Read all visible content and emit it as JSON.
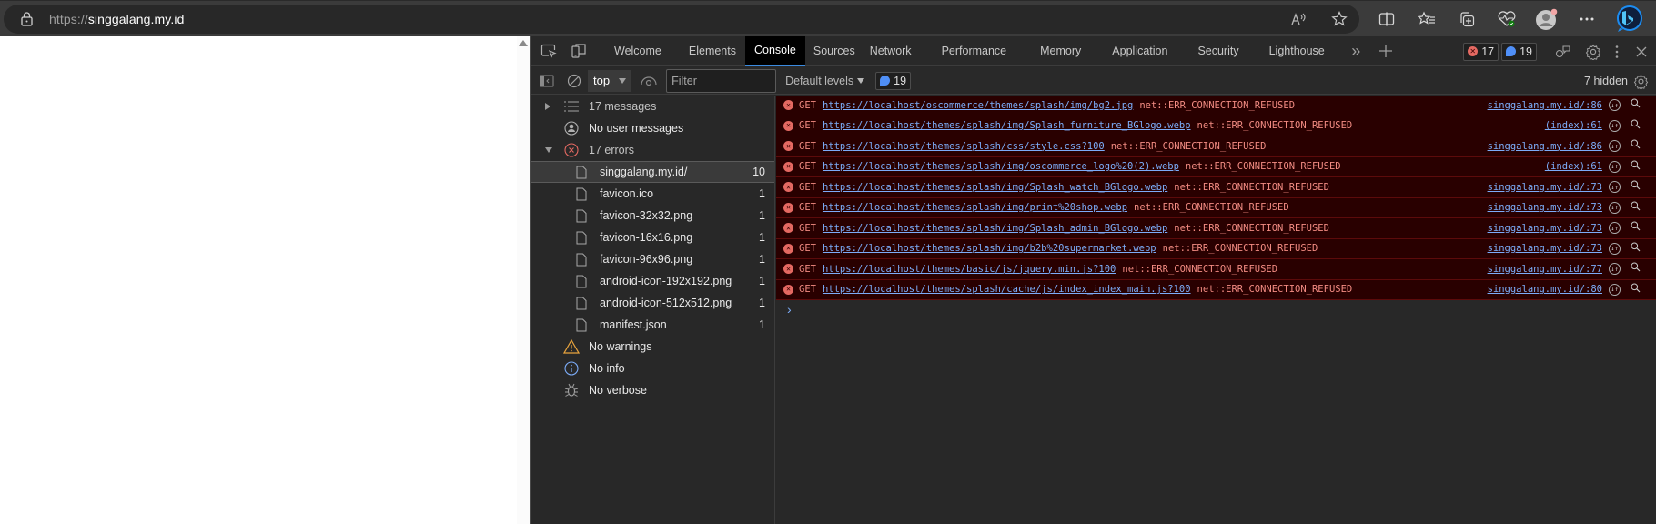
{
  "browser": {
    "url_scheme": "https://",
    "url_host": "singgalang.my.id",
    "address_icons": [
      "read-aloud-icon",
      "favorite-star-icon"
    ],
    "toolbar_icons": [
      "split-screen-icon",
      "favorites-icon",
      "collections-icon",
      "browser-essentials-icon",
      "profile-avatar-icon",
      "more-menu-icon",
      "bing-copilot-icon"
    ]
  },
  "devtools": {
    "tabs": [
      {
        "label": "Welcome",
        "active": false
      },
      {
        "label": "Elements",
        "active": false
      },
      {
        "label": "Console",
        "active": true
      },
      {
        "label": "Sources",
        "active": false
      },
      {
        "label": "Network",
        "active": false
      },
      {
        "label": "Performance",
        "active": false
      },
      {
        "label": "Memory",
        "active": false
      },
      {
        "label": "Application",
        "active": false
      },
      {
        "label": "Security",
        "active": false
      },
      {
        "label": "Lighthouse",
        "active": false
      }
    ],
    "error_count": "17",
    "message_count": "19",
    "toolbar": {
      "context": "top",
      "filter_placeholder": "Filter",
      "levels_label": "Default levels",
      "issues_count": "19",
      "hidden_label": "7 hidden"
    },
    "sidebar": {
      "messages": "17 messages",
      "user_messages": "No user messages",
      "errors": "17 errors",
      "files": [
        {
          "name": "singgalang.my.id/",
          "count": "10"
        },
        {
          "name": "favicon.ico",
          "count": "1"
        },
        {
          "name": "favicon-32x32.png",
          "count": "1"
        },
        {
          "name": "favicon-16x16.png",
          "count": "1"
        },
        {
          "name": "favicon-96x96.png",
          "count": "1"
        },
        {
          "name": "android-icon-192x192.png",
          "count": "1"
        },
        {
          "name": "android-icon-512x512.png",
          "count": "1"
        },
        {
          "name": "manifest.json",
          "count": "1"
        }
      ],
      "warnings": "No warnings",
      "info": "No info",
      "verbose": "No verbose"
    },
    "console": {
      "colors": {
        "error_bg": "#290000",
        "error_text": "#f28b82",
        "link": "#7cacf8"
      },
      "messages": [
        {
          "method": "GET",
          "url": "https://localhost/oscommerce/themes/splash/img/bg2.jpg",
          "error": "net::ERR_CONNECTION_REFUSED",
          "source": "singgalang.my.id/:86"
        },
        {
          "method": "GET",
          "url": "https://localhost/themes/splash/img/Splash_furniture_BGlogo.webp",
          "error": "net::ERR_CONNECTION_REFUSED",
          "source": "(index):61"
        },
        {
          "method": "GET",
          "url": "https://localhost/themes/splash/css/style.css?100",
          "error": "net::ERR_CONNECTION_REFUSED",
          "source": "singgalang.my.id/:86"
        },
        {
          "method": "GET",
          "url": "https://localhost/themes/splash/img/oscommerce_logo%20(2).webp",
          "error": "net::ERR_CONNECTION_REFUSED",
          "source": "(index):61"
        },
        {
          "method": "GET",
          "url": "https://localhost/themes/splash/img/Splash_watch_BGlogo.webp",
          "error": "net::ERR_CONNECTION_REFUSED",
          "source": "singgalang.my.id/:73"
        },
        {
          "method": "GET",
          "url": "https://localhost/themes/splash/img/print%20shop.webp",
          "error": "net::ERR_CONNECTION_REFUSED",
          "source": "singgalang.my.id/:73"
        },
        {
          "method": "GET",
          "url": "https://localhost/themes/splash/img/Splash_admin_BGlogo.webp",
          "error": "net::ERR_CONNECTION_REFUSED",
          "source": "singgalang.my.id/:73"
        },
        {
          "method": "GET",
          "url": "https://localhost/themes/splash/img/b2b%20supermarket.webp",
          "error": "net::ERR_CONNECTION_REFUSED",
          "source": "singgalang.my.id/:73"
        },
        {
          "method": "GET",
          "url": "https://localhost/themes/basic/js/jquery.min.js?100",
          "error": "net::ERR_CONNECTION_REFUSED",
          "source": "singgalang.my.id/:77"
        },
        {
          "method": "GET",
          "url": "https://localhost/themes/splash/cache/js/index_index_main.js?100",
          "error": "net::ERR_CONNECTION_REFUSED",
          "source": "singgalang.my.id/:80"
        }
      ],
      "prompt_symbol": "›"
    }
  }
}
